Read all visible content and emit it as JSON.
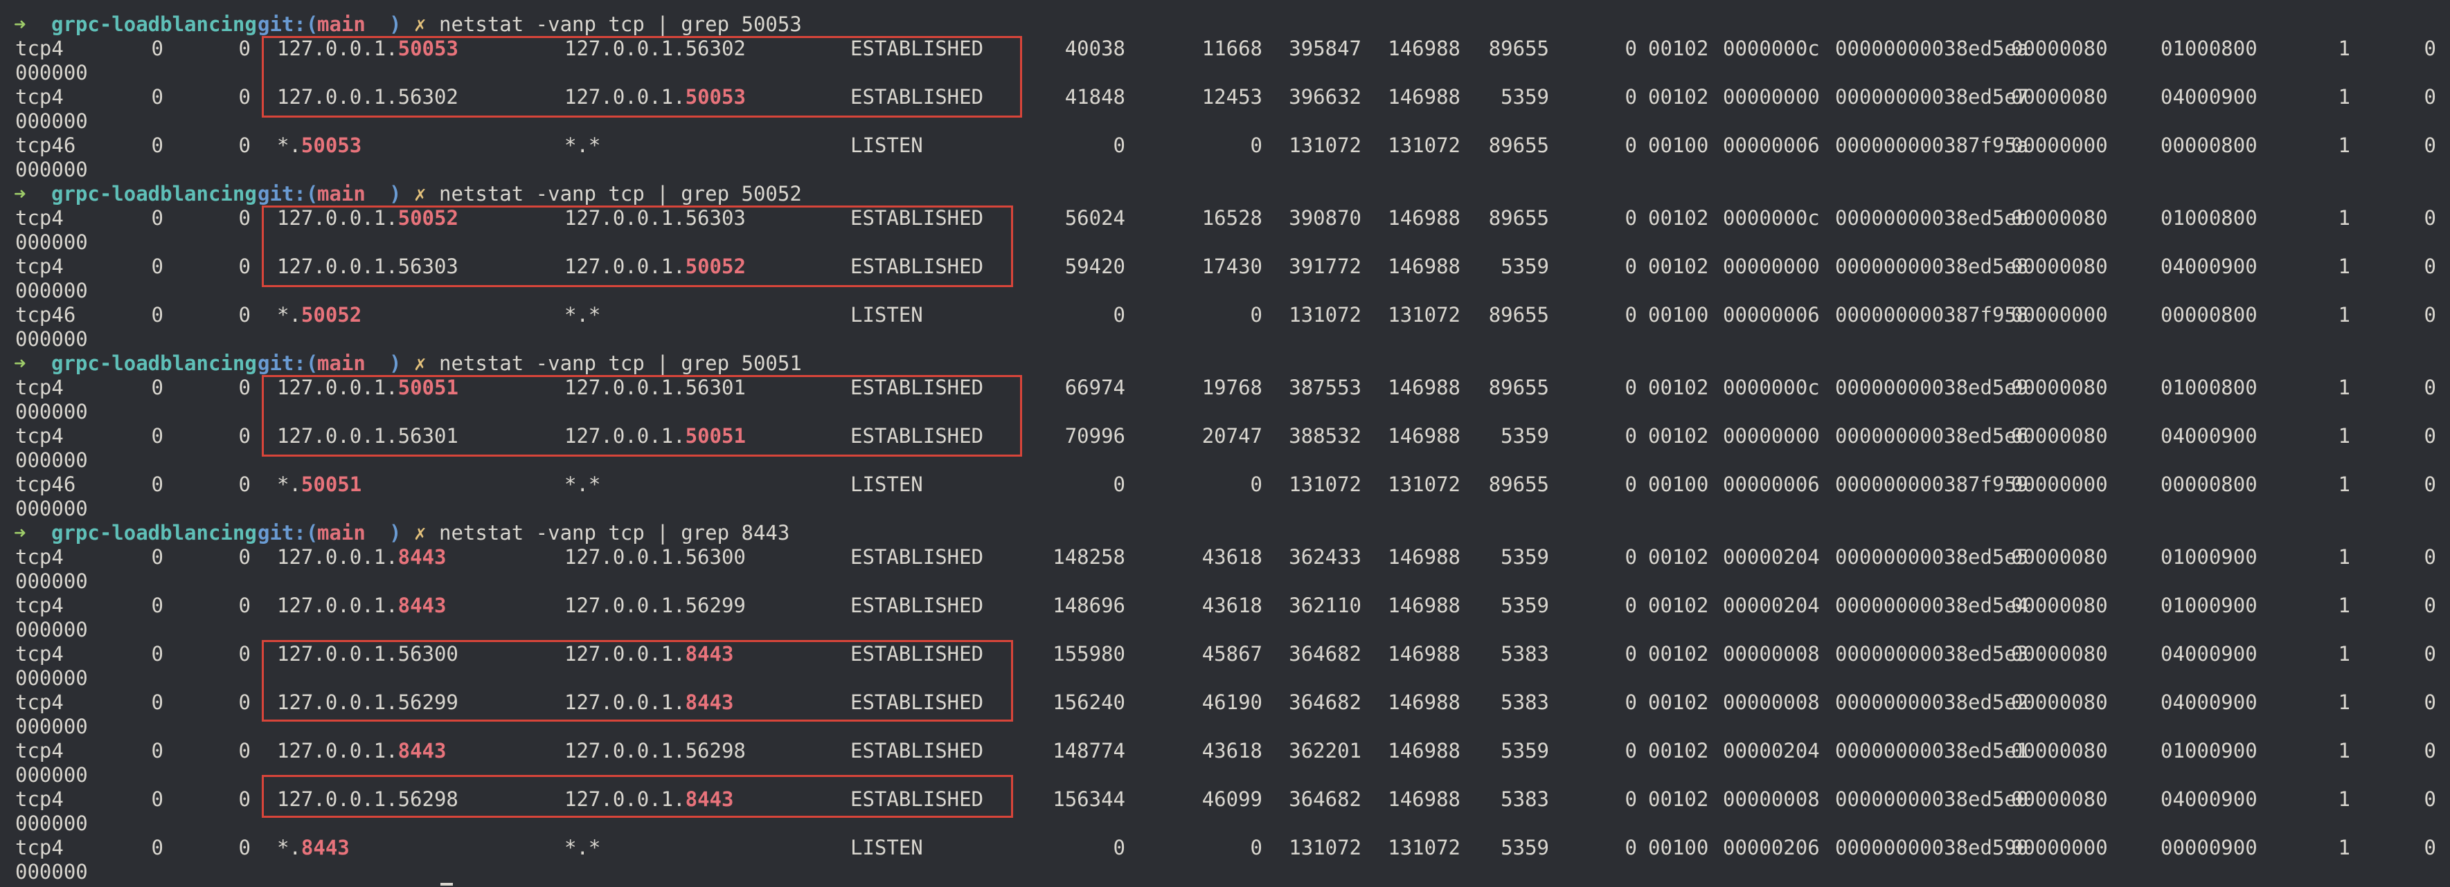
{
  "colors": {
    "background": "#2c2e33",
    "text": "#d9d6cf",
    "highlight": "#e8737b",
    "box": "#d8453a",
    "prompt_arrow": "#9fcd6a",
    "prompt_dir": "#5fc0b8",
    "prompt_git": "#6a9bd3",
    "prompt_branch": "#e2727b"
  },
  "prompt": {
    "arrow": "➜",
    "dir": "grpc-loadblancing",
    "git_prefix": "git:(",
    "branch": "main",
    "git_suffix": ")",
    "dirty": "✗"
  },
  "blocks": [
    {
      "command": "netstat -vanp tcp | grep 50053",
      "rows": [
        {
          "proto": "tcp4",
          "recvq": "0",
          "sendq": "0",
          "local_pre": "127.0.0.1.",
          "local_hl": "50053",
          "local_post": "",
          "foreign_pre": "127.0.0.1.56302",
          "foreign_hl": "",
          "state": "ESTABLISHED",
          "rhiwat": "40038",
          "shiwat": "11668",
          "rxbytes": "395847",
          "txbytes": "146988",
          "pid": "89655",
          "epid": "0",
          "state2": "00102",
          "flags": "0000000c",
          "gencnt": "00000000038ed5ea",
          "f4": "00000080",
          "f5": "01000800",
          "f6": "1",
          "f7": "0",
          "wrap": "000000"
        },
        {
          "proto": "tcp4",
          "recvq": "0",
          "sendq": "0",
          "local_pre": "127.0.0.1.56302",
          "local_hl": "",
          "local_post": "",
          "foreign_pre": "127.0.0.1.",
          "foreign_hl": "50053",
          "state": "ESTABLISHED",
          "rhiwat": "41848",
          "shiwat": "12453",
          "rxbytes": "396632",
          "txbytes": "146988",
          "pid": "5359",
          "epid": "0",
          "state2": "00102",
          "flags": "00000000",
          "gencnt": "00000000038ed5e7",
          "f4": "00000080",
          "f5": "04000900",
          "f6": "1",
          "f7": "0",
          "wrap": "000000"
        },
        {
          "proto": "tcp46",
          "recvq": "0",
          "sendq": "0",
          "local_pre": "*.",
          "local_hl": "50053",
          "local_post": "",
          "foreign_pre": "*.*",
          "foreign_hl": "",
          "state": "LISTEN",
          "rhiwat": "0",
          "shiwat": "0",
          "rxbytes": "131072",
          "txbytes": "131072",
          "pid": "89655",
          "epid": "0",
          "state2": "00100",
          "flags": "00000006",
          "gencnt": "000000000387f95a",
          "f4": "00000000",
          "f5": "00000800",
          "f6": "1",
          "f7": "0",
          "wrap": "000000"
        }
      ]
    },
    {
      "command": "netstat -vanp tcp | grep 50052",
      "rows": [
        {
          "proto": "tcp4",
          "recvq": "0",
          "sendq": "0",
          "local_pre": "127.0.0.1.",
          "local_hl": "50052",
          "local_post": "",
          "foreign_pre": "127.0.0.1.56303",
          "foreign_hl": "",
          "state": "ESTABLISHED",
          "rhiwat": "56024",
          "shiwat": "16528",
          "rxbytes": "390870",
          "txbytes": "146988",
          "pid": "89655",
          "epid": "0",
          "state2": "00102",
          "flags": "0000000c",
          "gencnt": "00000000038ed5eb",
          "f4": "00000080",
          "f5": "01000800",
          "f6": "1",
          "f7": "0",
          "wrap": "000000"
        },
        {
          "proto": "tcp4",
          "recvq": "0",
          "sendq": "0",
          "local_pre": "127.0.0.1.56303",
          "local_hl": "",
          "local_post": "",
          "foreign_pre": "127.0.0.1.",
          "foreign_hl": "50052",
          "state": "ESTABLISHED",
          "rhiwat": "59420",
          "shiwat": "17430",
          "rxbytes": "391772",
          "txbytes": "146988",
          "pid": "5359",
          "epid": "0",
          "state2": "00102",
          "flags": "00000000",
          "gencnt": "00000000038ed5e8",
          "f4": "00000080",
          "f5": "04000900",
          "f6": "1",
          "f7": "0",
          "wrap": "000000"
        },
        {
          "proto": "tcp46",
          "recvq": "0",
          "sendq": "0",
          "local_pre": "*.",
          "local_hl": "50052",
          "local_post": "",
          "foreign_pre": "*.*",
          "foreign_hl": "",
          "state": "LISTEN",
          "rhiwat": "0",
          "shiwat": "0",
          "rxbytes": "131072",
          "txbytes": "131072",
          "pid": "89655",
          "epid": "0",
          "state2": "00100",
          "flags": "00000006",
          "gencnt": "000000000387f958",
          "f4": "00000000",
          "f5": "00000800",
          "f6": "1",
          "f7": "0",
          "wrap": "000000"
        }
      ]
    },
    {
      "command": "netstat -vanp tcp | grep 50051",
      "rows": [
        {
          "proto": "tcp4",
          "recvq": "0",
          "sendq": "0",
          "local_pre": "127.0.0.1.",
          "local_hl": "50051",
          "local_post": "",
          "foreign_pre": "127.0.0.1.56301",
          "foreign_hl": "",
          "state": "ESTABLISHED",
          "rhiwat": "66974",
          "shiwat": "19768",
          "rxbytes": "387553",
          "txbytes": "146988",
          "pid": "89655",
          "epid": "0",
          "state2": "00102",
          "flags": "0000000c",
          "gencnt": "00000000038ed5e9",
          "f4": "00000080",
          "f5": "01000800",
          "f6": "1",
          "f7": "0",
          "wrap": "000000"
        },
        {
          "proto": "tcp4",
          "recvq": "0",
          "sendq": "0",
          "local_pre": "127.0.0.1.56301",
          "local_hl": "",
          "local_post": "",
          "foreign_pre": "127.0.0.1.",
          "foreign_hl": "50051",
          "state": "ESTABLISHED",
          "rhiwat": "70996",
          "shiwat": "20747",
          "rxbytes": "388532",
          "txbytes": "146988",
          "pid": "5359",
          "epid": "0",
          "state2": "00102",
          "flags": "00000000",
          "gencnt": "00000000038ed5e6",
          "f4": "00000080",
          "f5": "04000900",
          "f6": "1",
          "f7": "0",
          "wrap": "000000"
        },
        {
          "proto": "tcp46",
          "recvq": "0",
          "sendq": "0",
          "local_pre": "*.",
          "local_hl": "50051",
          "local_post": "",
          "foreign_pre": "*.*",
          "foreign_hl": "",
          "state": "LISTEN",
          "rhiwat": "0",
          "shiwat": "0",
          "rxbytes": "131072",
          "txbytes": "131072",
          "pid": "89655",
          "epid": "0",
          "state2": "00100",
          "flags": "00000006",
          "gencnt": "000000000387f959",
          "f4": "00000000",
          "f5": "00000800",
          "f6": "1",
          "f7": "0",
          "wrap": "000000"
        }
      ]
    },
    {
      "command": "netstat -vanp tcp | grep 8443",
      "rows": [
        {
          "proto": "tcp4",
          "recvq": "0",
          "sendq": "0",
          "local_pre": "127.0.0.1.",
          "local_hl": "8443",
          "local_post": "",
          "foreign_pre": "127.0.0.1.56300",
          "foreign_hl": "",
          "state": "ESTABLISHED",
          "rhiwat": "148258",
          "shiwat": "43618",
          "rxbytes": "362433",
          "txbytes": "146988",
          "pid": "5359",
          "epid": "0",
          "state2": "00102",
          "flags": "00000204",
          "gencnt": "00000000038ed5e5",
          "f4": "00000080",
          "f5": "01000900",
          "f6": "1",
          "f7": "0",
          "wrap": "000000"
        },
        {
          "proto": "tcp4",
          "recvq": "0",
          "sendq": "0",
          "local_pre": "127.0.0.1.",
          "local_hl": "8443",
          "local_post": "",
          "foreign_pre": "127.0.0.1.56299",
          "foreign_hl": "",
          "state": "ESTABLISHED",
          "rhiwat": "148696",
          "shiwat": "43618",
          "rxbytes": "362110",
          "txbytes": "146988",
          "pid": "5359",
          "epid": "0",
          "state2": "00102",
          "flags": "00000204",
          "gencnt": "00000000038ed5e4",
          "f4": "00000080",
          "f5": "01000900",
          "f6": "1",
          "f7": "0",
          "wrap": "000000"
        },
        {
          "proto": "tcp4",
          "recvq": "0",
          "sendq": "0",
          "local_pre": "127.0.0.1.56300",
          "local_hl": "",
          "local_post": "",
          "foreign_pre": "127.0.0.1.",
          "foreign_hl": "8443",
          "state": "ESTABLISHED",
          "rhiwat": "155980",
          "shiwat": "45867",
          "rxbytes": "364682",
          "txbytes": "146988",
          "pid": "5383",
          "epid": "0",
          "state2": "00102",
          "flags": "00000008",
          "gencnt": "00000000038ed5e3",
          "f4": "00000080",
          "f5": "04000900",
          "f6": "1",
          "f7": "0",
          "wrap": "000000"
        },
        {
          "proto": "tcp4",
          "recvq": "0",
          "sendq": "0",
          "local_pre": "127.0.0.1.56299",
          "local_hl": "",
          "local_post": "",
          "foreign_pre": "127.0.0.1.",
          "foreign_hl": "8443",
          "state": "ESTABLISHED",
          "rhiwat": "156240",
          "shiwat": "46190",
          "rxbytes": "364682",
          "txbytes": "146988",
          "pid": "5383",
          "epid": "0",
          "state2": "00102",
          "flags": "00000008",
          "gencnt": "00000000038ed5e2",
          "f4": "00000080",
          "f5": "04000900",
          "f6": "1",
          "f7": "0",
          "wrap": "000000"
        },
        {
          "proto": "tcp4",
          "recvq": "0",
          "sendq": "0",
          "local_pre": "127.0.0.1.",
          "local_hl": "8443",
          "local_post": "",
          "foreign_pre": "127.0.0.1.56298",
          "foreign_hl": "",
          "state": "ESTABLISHED",
          "rhiwat": "148774",
          "shiwat": "43618",
          "rxbytes": "362201",
          "txbytes": "146988",
          "pid": "5359",
          "epid": "0",
          "state2": "00102",
          "flags": "00000204",
          "gencnt": "00000000038ed5e1",
          "f4": "00000080",
          "f5": "01000900",
          "f6": "1",
          "f7": "0",
          "wrap": "000000"
        },
        {
          "proto": "tcp4",
          "recvq": "0",
          "sendq": "0",
          "local_pre": "127.0.0.1.56298",
          "local_hl": "",
          "local_post": "",
          "foreign_pre": "127.0.0.1.",
          "foreign_hl": "8443",
          "state": "ESTABLISHED",
          "rhiwat": "156344",
          "shiwat": "46099",
          "rxbytes": "364682",
          "txbytes": "146988",
          "pid": "5383",
          "epid": "0",
          "state2": "00102",
          "flags": "00000008",
          "gencnt": "00000000038ed5e0",
          "f4": "00000080",
          "f5": "04000900",
          "f6": "1",
          "f7": "0",
          "wrap": "000000"
        },
        {
          "proto": "tcp4",
          "recvq": "0",
          "sendq": "0",
          "local_pre": "*.",
          "local_hl": "8443",
          "local_post": "",
          "foreign_pre": "*.*",
          "foreign_hl": "",
          "state": "LISTEN",
          "rhiwat": "0",
          "shiwat": "0",
          "rxbytes": "131072",
          "txbytes": "131072",
          "pid": "5359",
          "epid": "0",
          "state2": "00100",
          "flags": "00000206",
          "gencnt": "00000000038ed590",
          "f4": "00000000",
          "f5": "00000900",
          "f6": "1",
          "f7": "0",
          "wrap": "000000"
        }
      ]
    }
  ]
}
